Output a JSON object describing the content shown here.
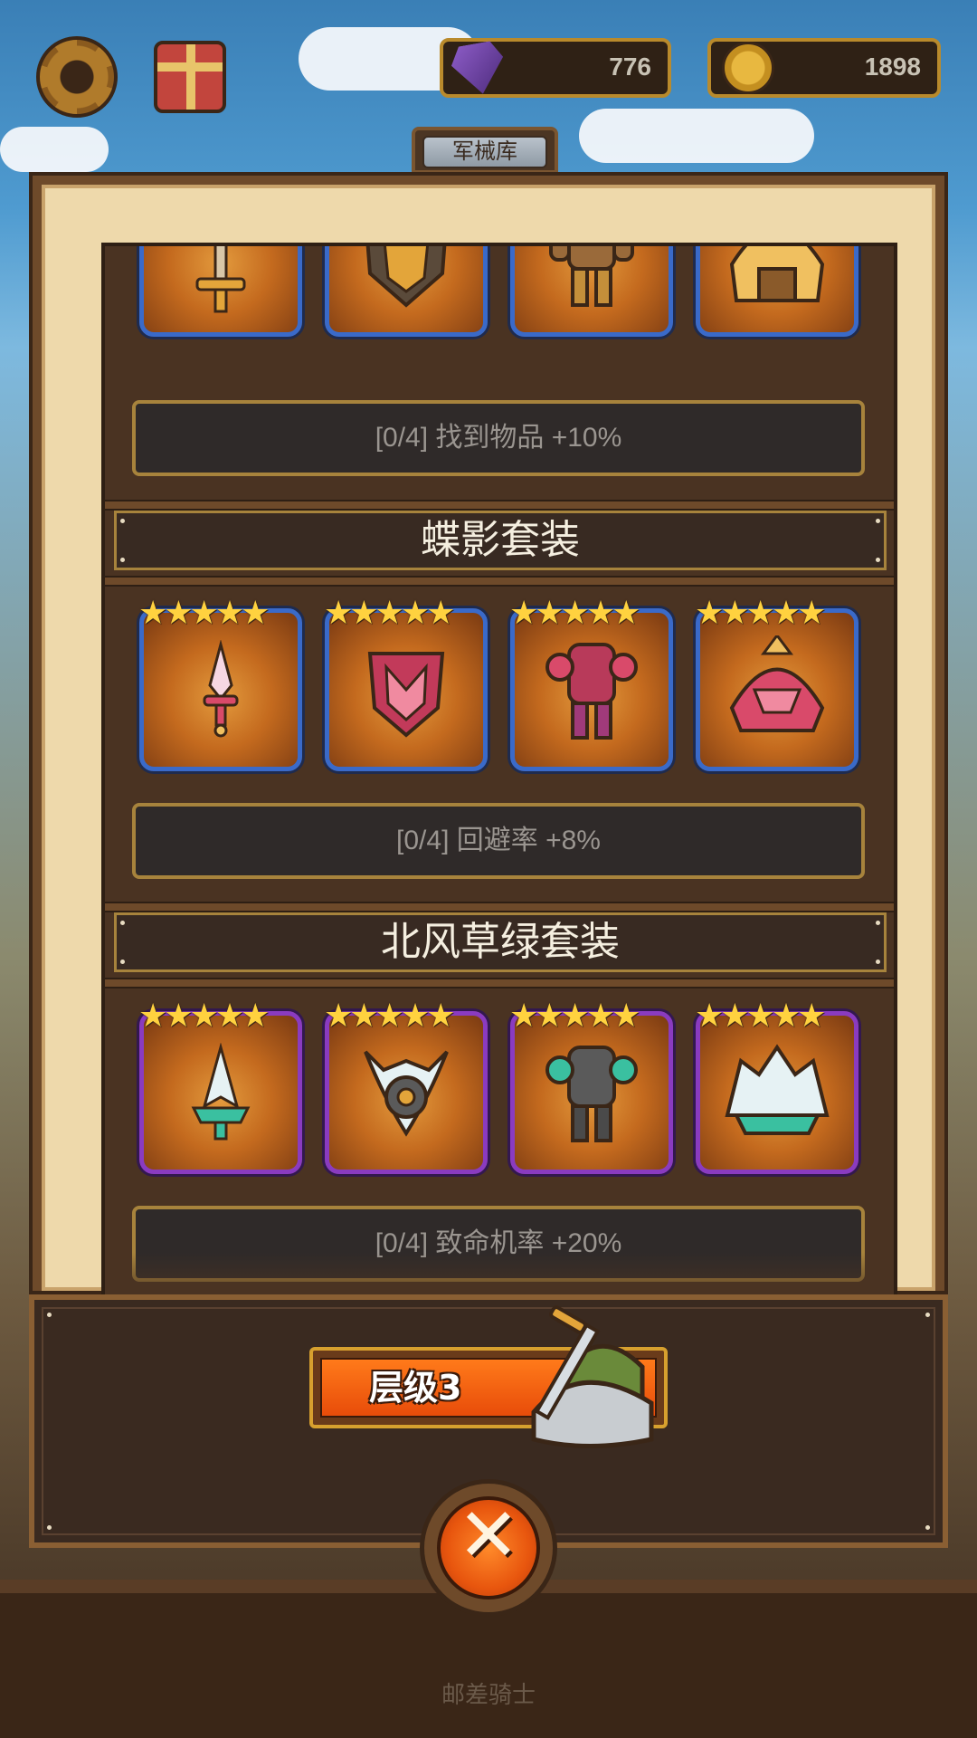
{
  "hud": {
    "gems": "776",
    "coins": "1898",
    "settings_icon": "gear-icon",
    "gift_icon": "gift-icon"
  },
  "panel": {
    "tab_label": "军械库"
  },
  "sets": [
    {
      "title": "",
      "bonus": "[0/4] 找到物品 +10%",
      "items": [
        "sword-icon",
        "shield-icon",
        "armor-icon",
        "helmet-icon"
      ]
    },
    {
      "title": "蝶影套装",
      "stars": "★★★★★",
      "bonus": "[0/4] 回避率 +8%",
      "items": [
        "dagger-icon",
        "butterfly-shield-icon",
        "armor-icon",
        "helmet-icon"
      ]
    },
    {
      "title": "北风草绿套装",
      "stars": "★★★★★",
      "bonus": "[0/4] 致命机率 +20%",
      "items": [
        "spear-icon",
        "shield-icon",
        "armor-icon",
        "helmet-icon"
      ]
    }
  ],
  "level": {
    "label": "层级3"
  },
  "footer": {
    "text": "邮差骑士"
  },
  "colors": {
    "rare_border": "#3a6ac9",
    "epic_border": "#8a3bc0",
    "accent_orange": "#e84c0a"
  }
}
